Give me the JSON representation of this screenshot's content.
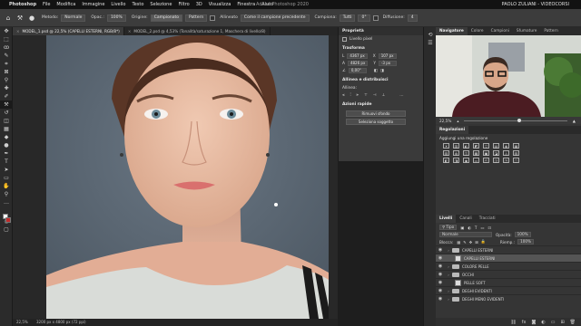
{
  "menubar": {
    "items": [
      "Photoshop",
      "File",
      "Modifica",
      "Immagine",
      "Livello",
      "Testo",
      "Selezione",
      "Filtro",
      "3D",
      "Visualizza",
      "Finestra",
      "Aiuto"
    ],
    "center_title": "Adobe Photoshop 2020",
    "right_user": "PAOLO ZULIANI - VIDEOCORSI"
  },
  "options_bar": {
    "mode_label": "Metodo:",
    "mode_value": "Normale",
    "opacity_label": "Opac.:",
    "opacity_value": "100%",
    "origin_label": "Origine:",
    "origin_value": "Campionato",
    "pattern_label": "Pattern",
    "align_label": "Allineato",
    "sample_label": "Come il campione precedente",
    "sample_layers_label": "Campiona:",
    "sample_layers_value": "Tutti",
    "angle_value": "0°",
    "diffusion_label": "Diffusione:",
    "diffusion_value": "4"
  },
  "tabs": [
    {
      "label": "MODEL_1.psd @ 22,5% (CAPELLI ESTERNI, RGB/8*)",
      "active": true
    },
    {
      "label": "MODEL_2.psd @ 4,53% (Tonalità/saturazione 1, Maschera di livello/8)",
      "active": false
    }
  ],
  "status": {
    "zoom": "22,5%",
    "doc_size": "3200 px x 4800 px (72 ppi)"
  },
  "properties": {
    "title": "Proprietà",
    "layer_type": "Livello pixel",
    "transform_title": "Trasforma",
    "w_label": "L",
    "w_value": "4367 px",
    "x_label": "X",
    "x_value": "107 px",
    "h_label": "A",
    "h_value": "4826 px",
    "y_label": "Y",
    "y_value": "-3 px",
    "angle_value": "0,00°",
    "align_title": "Allinea e distribuisci",
    "align_sub": "Allinea:",
    "quick_title": "Azioni rapide",
    "btn_remove_bg": "Rimuovi sfondo",
    "btn_select_subject": "Seleziona soggetto"
  },
  "navigator": {
    "tabs": [
      "Navigatore",
      "Colore",
      "Campioni",
      "Sfumature",
      "Pattern"
    ],
    "zoom": "22,5%",
    "zoom_level": 0.52
  },
  "adjustments": {
    "tab": "Regolazioni",
    "add_label": "Aggiungi una regolazione",
    "icons_row1": [
      "☀",
      "▥",
      "◐",
      "◩",
      "▽",
      "▤",
      "◈",
      "▦"
    ],
    "icons_row2": [
      "▧",
      "◍",
      "◫",
      "▩",
      "▣",
      "◪",
      "◬",
      "▨"
    ],
    "icons_row3": [
      "◧",
      "◨",
      "◉",
      "▭",
      "◰",
      "◲",
      "◳",
      "▢"
    ]
  },
  "layers": {
    "tabs": [
      "Livelli",
      "Canali",
      "Tracciati"
    ],
    "kind_label": "Tipo",
    "blend_value": "Normale",
    "opacity_label": "Opacità:",
    "opacity_value": "100%",
    "lock_label": "Blocca:",
    "fill_label": "Riemp.:",
    "fill_value": "100%",
    "items": [
      {
        "name": "CAPELLI ESTERNI",
        "type": "folder",
        "selected": false
      },
      {
        "name": "CAPELLI ESTERNI",
        "type": "pixel",
        "selected": true
      },
      {
        "name": "COLORE PELLE",
        "type": "folder",
        "selected": false
      },
      {
        "name": "OCCHI",
        "type": "folder",
        "selected": false
      },
      {
        "name": "PELLE SOFT",
        "type": "pixel",
        "selected": false
      },
      {
        "name": "DEGHI EVIDENTI",
        "type": "folder",
        "selected": false
      },
      {
        "name": "DEGHI MENO EVIDENTI",
        "type": "folder",
        "selected": false
      }
    ]
  },
  "colors": {
    "accent": "#2d6bd6",
    "menubar_bg": "#121212",
    "panel_bg": "#3a3a3a",
    "canvas_bg": "#282828",
    "photo_bg": "#5d6975"
  }
}
